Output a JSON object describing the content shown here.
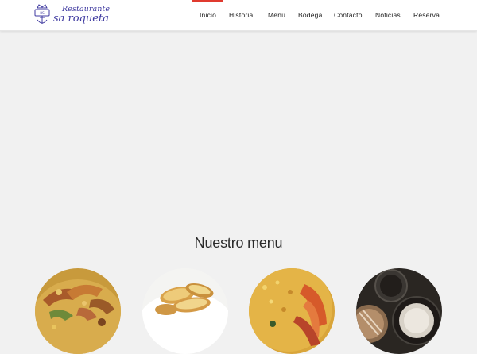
{
  "header": {
    "logo": {
      "line1": "Restaurante",
      "line2": "sa roqueta",
      "emblem_icon": "anchor-crest-icon",
      "color": "#3f3aa0"
    },
    "nav": {
      "active": "Inicio",
      "accent_color": "#e03a2f",
      "items": [
        {
          "label": "Inicio"
        },
        {
          "label": "Historia"
        },
        {
          "label": "Menú"
        },
        {
          "label": "Bodega"
        },
        {
          "label": "Contacto"
        },
        {
          "label": "Noticias"
        },
        {
          "label": "Reserva"
        }
      ]
    }
  },
  "main": {
    "menu_section": {
      "title": "Nuestro menu",
      "dishes": [
        {
          "image": "paella-dish-image"
        },
        {
          "image": "potatoes-dish-image"
        },
        {
          "image": "seafood-paella-image"
        },
        {
          "image": "cooking-pans-image"
        }
      ]
    }
  }
}
